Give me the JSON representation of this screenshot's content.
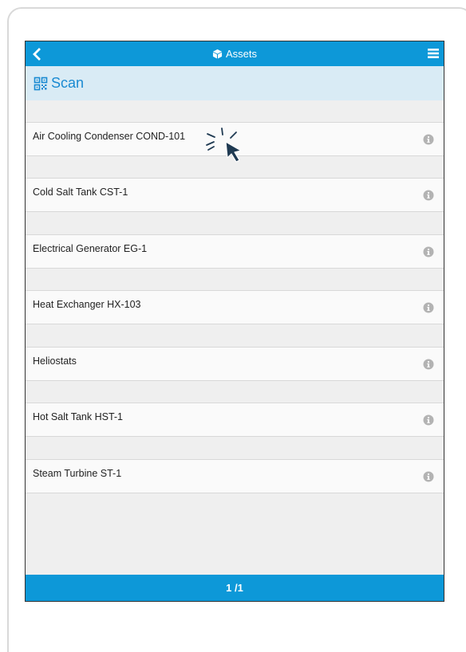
{
  "header": {
    "title": "Assets",
    "back_icon": "chevron-left-icon",
    "title_icon": "cube-icon",
    "menu_icon": "hamburger-menu-icon"
  },
  "scan": {
    "label": "Scan",
    "icon": "qr-code-icon"
  },
  "assets": [
    {
      "name": "Air Cooling Condenser COND-101"
    },
    {
      "name": "Cold Salt Tank CST-1"
    },
    {
      "name": "Electrical Generator EG-1"
    },
    {
      "name": "Heat Exchanger HX-103"
    },
    {
      "name": "Heliostats"
    },
    {
      "name": "Hot Salt Tank HST-1"
    },
    {
      "name": "Steam Turbine ST-1"
    }
  ],
  "pagination": {
    "label": "1 /1"
  },
  "colors": {
    "primary": "#0d98d8",
    "scan_bar": "#d9ebf5",
    "scan_text": "#1a8ad2",
    "list_background": "#efefef",
    "row_background": "#fafafa",
    "info_icon": "#b3b3b3"
  }
}
